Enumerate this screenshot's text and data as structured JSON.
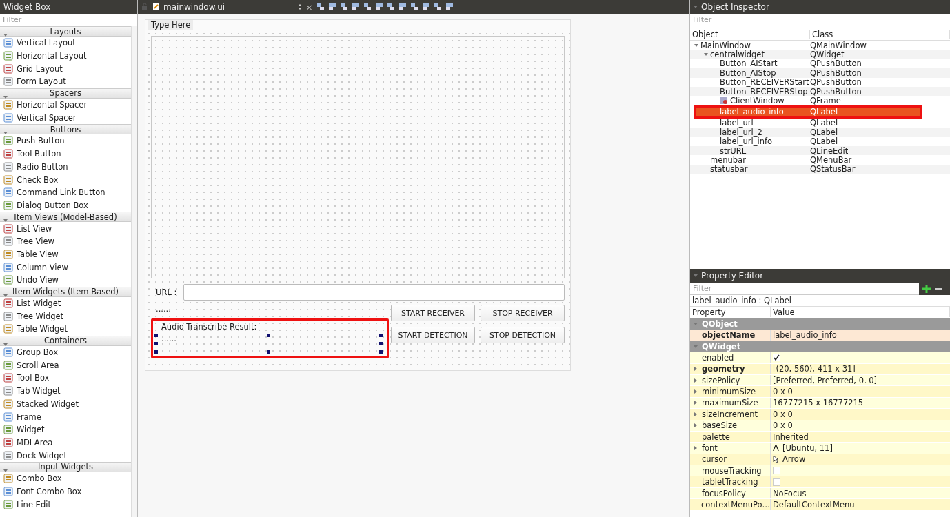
{
  "widget_box": {
    "title": "Widget Box",
    "filter_placeholder": "Filter",
    "categories": [
      {
        "name": "Layouts",
        "expanded": true,
        "items": [
          "Vertical Layout",
          "Horizontal Layout",
          "Grid Layout",
          "Form Layout"
        ]
      },
      {
        "name": "Spacers",
        "expanded": true,
        "items": [
          "Horizontal Spacer",
          "Vertical Spacer"
        ]
      },
      {
        "name": "Buttons",
        "expanded": true,
        "items": [
          "Push Button",
          "Tool Button",
          "Radio Button",
          "Check Box",
          "Command Link Button",
          "Dialog Button Box"
        ]
      },
      {
        "name": "Item Views (Model-Based)",
        "expanded": true,
        "items": [
          "List View",
          "Tree View",
          "Table View",
          "Column View",
          "Undo View"
        ]
      },
      {
        "name": "Item Widgets (Item-Based)",
        "expanded": true,
        "items": [
          "List Widget",
          "Tree Widget",
          "Table Widget"
        ]
      },
      {
        "name": "Containers",
        "expanded": true,
        "items": [
          "Group Box",
          "Scroll Area",
          "Tool Box",
          "Tab Widget",
          "Stacked Widget",
          "Frame",
          "Widget",
          "MDI Area",
          "Dock Widget"
        ]
      },
      {
        "name": "Input Widgets",
        "expanded": true,
        "items": [
          "Combo Box",
          "Font Combo Box",
          "Line Edit"
        ]
      }
    ]
  },
  "editor": {
    "file": "mainwindow.ui",
    "close": "×"
  },
  "form": {
    "menu_placeholder": "Type Here",
    "url_label": "URL :",
    "url_info": "......",
    "audio_label": "Audio Transcribe Result:",
    "audio_info": "......",
    "audio_selected": true,
    "audio_annotated": true,
    "buttons": [
      {
        "label": "START RECEIVER"
      },
      {
        "label": "STOP RECEIVER"
      },
      {
        "label": "START DETECTION"
      },
      {
        "label": "STOP DETECTION"
      }
    ]
  },
  "object_inspector": {
    "title": "Object Inspector",
    "filter_placeholder": "Filter",
    "columns": [
      "Object",
      "Class"
    ],
    "tree": [
      {
        "name": "MainWindow",
        "class": "QMainWindow",
        "selected": false,
        "annotated": false,
        "expanded": true,
        "children": [
          {
            "name": "centralwidget",
            "class": "QWidget",
            "selected": false,
            "annotated": false,
            "expanded": true,
            "children": [
              {
                "name": "Button_AIStart",
                "class": "QPushButton",
                "selected": false,
                "annotated": false
              },
              {
                "name": "Button_AIStop",
                "class": "QPushButton",
                "selected": false,
                "annotated": false
              },
              {
                "name": "Button_RECEIVERStart",
                "class": "QPushButton",
                "selected": false,
                "annotated": false
              },
              {
                "name": "Button_RECEIVERStop",
                "class": "QPushButton",
                "selected": false,
                "annotated": false
              },
              {
                "name": "ClientWindow",
                "class": "QFrame",
                "selected": false,
                "annotated": false,
                "icon": true
              },
              {
                "name": "label_audio_info",
                "class": "QLabel",
                "selected": true,
                "annotated": true
              },
              {
                "name": "label_url",
                "class": "QLabel",
                "selected": false,
                "annotated": false
              },
              {
                "name": "label_url_2",
                "class": "QLabel",
                "selected": false,
                "annotated": false
              },
              {
                "name": "label_url_info",
                "class": "QLabel",
                "selected": false,
                "annotated": false
              },
              {
                "name": "strURL",
                "class": "QLineEdit",
                "selected": false,
                "annotated": false
              }
            ]
          },
          {
            "name": "menubar",
            "class": "QMenuBar",
            "selected": false,
            "annotated": false
          },
          {
            "name": "statusbar",
            "class": "QStatusBar",
            "selected": false,
            "annotated": false
          }
        ]
      }
    ]
  },
  "property_editor": {
    "title": "Property Editor",
    "filter_placeholder": "Filter",
    "target": "label_audio_info : QLabel",
    "columns": [
      "Property",
      "Value"
    ],
    "sections": [
      {
        "name": "QObject",
        "expanded": true,
        "properties": [
          {
            "name": "objectName",
            "kind": "text",
            "value": "label_audio_info",
            "bold": true,
            "expandable": false
          }
        ]
      },
      {
        "name": "QWidget",
        "expanded": true,
        "properties": [
          {
            "name": "enabled",
            "kind": "checkbox",
            "checked": true,
            "bold": false,
            "expandable": false
          },
          {
            "name": "geometry",
            "kind": "text",
            "value": "[(20, 560), 411 x 31]",
            "bold": true,
            "expandable": true
          },
          {
            "name": "sizePolicy",
            "kind": "text",
            "value": "[Preferred, Preferred, 0, 0]",
            "bold": false,
            "expandable": true
          },
          {
            "name": "minimumSize",
            "kind": "text",
            "value": "0 x 0",
            "bold": false,
            "expandable": true
          },
          {
            "name": "maximumSize",
            "kind": "text",
            "value": "16777215 x 16777215",
            "bold": false,
            "expandable": true
          },
          {
            "name": "sizeIncrement",
            "kind": "text",
            "value": "0 x 0",
            "bold": false,
            "expandable": true
          },
          {
            "name": "baseSize",
            "kind": "text",
            "value": "0 x 0",
            "bold": false,
            "expandable": true
          },
          {
            "name": "palette",
            "kind": "text",
            "value": "Inherited",
            "bold": false,
            "expandable": false
          },
          {
            "name": "font",
            "kind": "font",
            "glyph": "A",
            "value": "[Ubuntu, 11]",
            "bold": false,
            "expandable": true
          },
          {
            "name": "cursor",
            "kind": "cursor",
            "value": "Arrow",
            "bold": false,
            "expandable": false
          },
          {
            "name": "mouseTracking",
            "kind": "checkbox",
            "checked": false,
            "bold": false,
            "expandable": false
          },
          {
            "name": "tabletTracking",
            "kind": "checkbox",
            "checked": false,
            "bold": false,
            "expandable": false
          },
          {
            "name": "focusPolicy",
            "kind": "text",
            "value": "NoFocus",
            "bold": false,
            "expandable": false
          },
          {
            "name": "contextMenuPo…",
            "kind": "text",
            "value": "DefaultContextMenu",
            "bold": false,
            "expandable": false
          }
        ]
      }
    ]
  }
}
